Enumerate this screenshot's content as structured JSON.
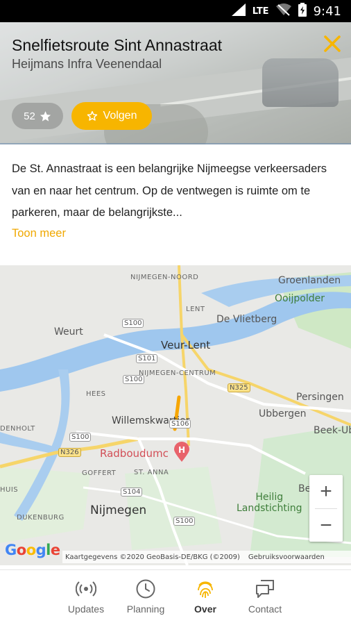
{
  "status_bar": {
    "network": "LTE",
    "time": "9:41"
  },
  "header": {
    "title": "Snelfietsroute Sint Annastraat",
    "subtitle": "Heijmans Infra Veenendaal",
    "rating": "52",
    "follow_label": "Volgen",
    "accent_color": "#f7b500"
  },
  "description": {
    "text": "De St. Annastraat is een belangrijke Nijmeegse verkeersaders van en naar het centrum. Op de ventwegen is ruimte om te parkeren, maar de belangrijkste...",
    "more_label": "Toon meer"
  },
  "map": {
    "labels": {
      "groenlanden": "Groenlanden",
      "ooijpolder": "Ooijpolder",
      "nijmegen_noord": "NIJMEGEN-NOORD",
      "lent": "LENT",
      "vlietberg": "De Vlietberg",
      "weurt": "Weurt",
      "veur_lent": "Veur-Lent",
      "nijmegen_centrum": "NIJMEGEN-CENTRUM",
      "hees": "HEES",
      "persingen": "Persingen",
      "ubbergen": "Ubbergen",
      "beek_ub": "Beek-Ub",
      "willemskwartier": "Willemskwartier",
      "denholt": "DENHOLT",
      "radboudumc": "Radboudumc",
      "goffert": "GOFFERT",
      "st_anna": "ST. ANNA",
      "heilig_landstichting": "Heilig\nLandstichting",
      "huis": "HUIS",
      "dukenburg": "DUKENBURG",
      "nijmegen": "Nijmegen",
      "be": "Be"
    },
    "road_labels": [
      "S100",
      "S101",
      "S100",
      "S106",
      "S100",
      "S104",
      "S100",
      "N325",
      "N326"
    ],
    "zoom_in": "+",
    "zoom_out": "−",
    "google_logo": "Google",
    "attribution": "Kaartgegevens ©2020 GeoBasis-DE/BKG (©2009)",
    "terms": "Gebruiksvoorwaarden"
  },
  "bottom_nav": [
    {
      "label": "Updates",
      "icon": "broadcast-icon"
    },
    {
      "label": "Planning",
      "icon": "clock-icon"
    },
    {
      "label": "Over",
      "icon": "fingerprint-icon",
      "active": true
    },
    {
      "label": "Contact",
      "icon": "chat-icon"
    }
  ]
}
